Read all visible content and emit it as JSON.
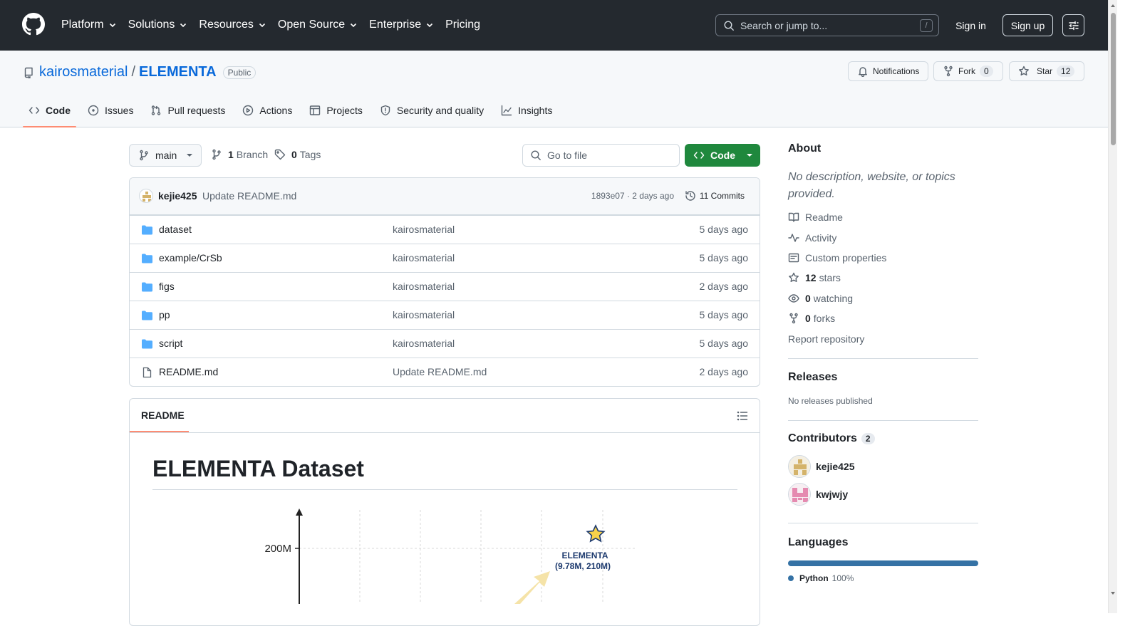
{
  "header": {
    "nav": [
      {
        "label": "Platform",
        "dropdown": true
      },
      {
        "label": "Solutions",
        "dropdown": true
      },
      {
        "label": "Resources",
        "dropdown": true
      },
      {
        "label": "Open Source",
        "dropdown": true
      },
      {
        "label": "Enterprise",
        "dropdown": true
      },
      {
        "label": "Pricing",
        "dropdown": false
      }
    ],
    "search_placeholder": "Search or jump to...",
    "search_shortcut": "/",
    "sign_in": "Sign in",
    "sign_up": "Sign up"
  },
  "repo": {
    "owner": "kairosmaterial",
    "separator": "/",
    "name": "ELEMENTA",
    "visibility": "Public",
    "notifications_label": "Notifications",
    "fork_label": "Fork",
    "fork_count": "0",
    "star_label": "Star",
    "star_count": "12",
    "tabs": [
      {
        "label": "Code",
        "icon": "code-icon",
        "active": true
      },
      {
        "label": "Issues",
        "icon": "issue-icon",
        "active": false
      },
      {
        "label": "Pull requests",
        "icon": "pull-request-icon",
        "active": false
      },
      {
        "label": "Actions",
        "icon": "play-icon",
        "active": false
      },
      {
        "label": "Projects",
        "icon": "table-icon",
        "active": false
      },
      {
        "label": "Security and quality",
        "icon": "shield-icon",
        "active": false
      },
      {
        "label": "Insights",
        "icon": "graph-icon",
        "active": false
      }
    ]
  },
  "filebar": {
    "branch": "main",
    "branch_count": "1",
    "branch_label": "Branch",
    "tag_count": "0",
    "tag_label": "Tags",
    "go_to_file": "Go to file",
    "code_button": "Code"
  },
  "latest_commit": {
    "author": "kejie425",
    "message": "Update README.md",
    "sha_date": "1893e07 · 2 days ago",
    "commits": "11 Commits"
  },
  "files": [
    {
      "name": "dataset",
      "type": "folder",
      "message": "kairosmaterial",
      "date": "5 days ago"
    },
    {
      "name": "example/CrSb",
      "type": "folder",
      "message": "kairosmaterial",
      "date": "5 days ago"
    },
    {
      "name": "figs",
      "type": "folder",
      "message": "kairosmaterial",
      "date": "2 days ago"
    },
    {
      "name": "pp",
      "type": "folder",
      "message": "kairosmaterial",
      "date": "5 days ago"
    },
    {
      "name": "script",
      "type": "folder",
      "message": "kairosmaterial",
      "date": "5 days ago"
    },
    {
      "name": "README.md",
      "type": "file",
      "message": "Update README.md",
      "date": "2 days ago"
    }
  ],
  "readme": {
    "tab": "README",
    "heading": "ELEMENTA Dataset",
    "figure": {
      "y_tick": "200M",
      "point_label_1": "ELEMENTA",
      "point_label_2": "(9.78M, 210M)"
    }
  },
  "sidebar": {
    "about_title": "About",
    "about_desc": "No description, website, or topics provided.",
    "links": [
      {
        "icon": "book-icon",
        "count": "",
        "label": "Readme"
      },
      {
        "icon": "pulse-icon",
        "count": "",
        "label": "Activity"
      },
      {
        "icon": "note-icon",
        "count": "",
        "label": "Custom properties"
      },
      {
        "icon": "star-icon",
        "count": "12",
        "label": "stars"
      },
      {
        "icon": "eye-icon",
        "count": "0",
        "label": "watching"
      },
      {
        "icon": "fork-icon",
        "count": "0",
        "label": "forks"
      }
    ],
    "report": "Report repository",
    "releases_title": "Releases",
    "releases_desc": "No releases published",
    "contributors_title": "Contributors",
    "contributors_count": "2",
    "contributors": [
      {
        "name": "kejie425"
      },
      {
        "name": "kwjwjy"
      }
    ],
    "languages_title": "Languages",
    "language": {
      "name": "Python",
      "percent": "100%",
      "color": "#3572a5"
    }
  },
  "colors": {
    "header_bg": "#24292f",
    "link": "#0969da",
    "primary_button": "#1f883d",
    "active_tab_underline": "#fd8c73"
  }
}
